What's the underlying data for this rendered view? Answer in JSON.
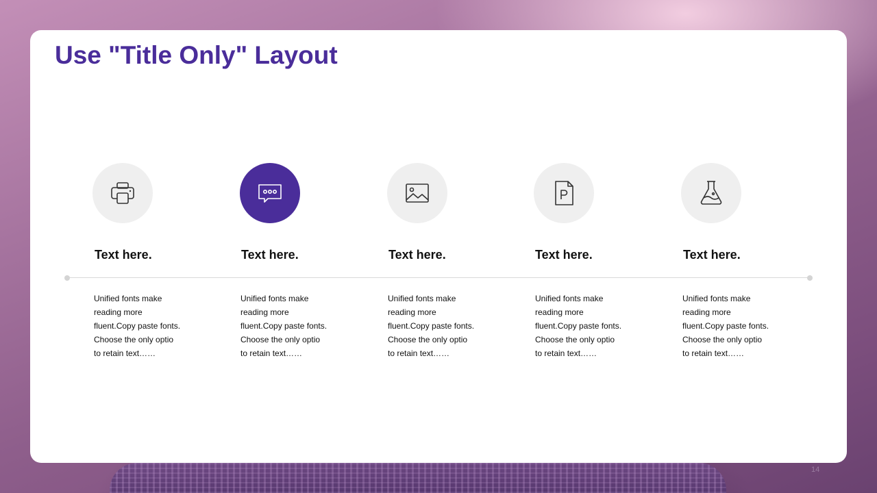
{
  "slide": {
    "title": "Use \"Title Only\" Layout",
    "page_number": "14",
    "accent_color": "#4a2d9a",
    "items": [
      {
        "icon": "printer-icon",
        "heading": "Text here.",
        "body": [
          "Unified fonts make",
          "reading more",
          "fluent.Copy paste fonts.",
          "Choose the only optio",
          "to retain text……"
        ],
        "active": false
      },
      {
        "icon": "chat-bubble-icon",
        "heading": "Text here.",
        "body": [
          "Unified fonts make",
          "reading more",
          "fluent.Copy paste fonts.",
          "Choose the only optio",
          "to retain text……"
        ],
        "active": true
      },
      {
        "icon": "image-icon",
        "heading": "Text here.",
        "body": [
          "Unified fonts make",
          "reading more",
          "fluent.Copy paste fonts.",
          "Choose the only optio",
          "to retain text……"
        ],
        "active": false
      },
      {
        "icon": "document-p-icon",
        "heading": "Text here.",
        "body": [
          "Unified fonts make",
          "reading more",
          "fluent.Copy paste fonts.",
          "Choose the only optio",
          "to retain text……"
        ],
        "active": false
      },
      {
        "icon": "flask-icon",
        "heading": "Text here.",
        "body": [
          "Unified fonts make",
          "reading more",
          "fluent.Copy paste fonts.",
          "Choose the only optio",
          "to retain text……"
        ],
        "active": false
      }
    ]
  }
}
